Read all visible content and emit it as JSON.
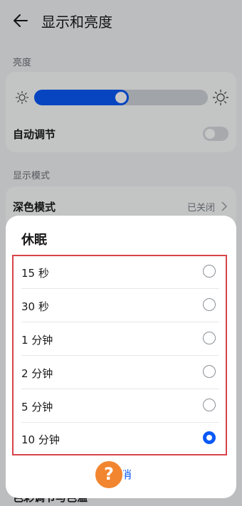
{
  "header": {
    "title": "显示和亮度"
  },
  "brightness": {
    "section_label": "亮度",
    "level_fraction": 0.5,
    "auto_label": "自动调节",
    "auto_on": false
  },
  "display_mode": {
    "section_label": "显示模式",
    "dark_mode_label": "深色模式",
    "dark_mode_value": "已关闭"
  },
  "behind_text": "色彩调节与色温",
  "sleep_dialog": {
    "title": "休眠",
    "options": [
      {
        "label": "15 秒",
        "selected": false
      },
      {
        "label": "30 秒",
        "selected": false
      },
      {
        "label": "1 分钟",
        "selected": false
      },
      {
        "label": "2 分钟",
        "selected": false
      },
      {
        "label": "5 分钟",
        "selected": false
      },
      {
        "label": "10 分钟",
        "selected": true
      }
    ],
    "cancel_label": "取消"
  },
  "colors": {
    "accent": "#0a59f7",
    "highlight": "#d9434a",
    "help_badge": "#f2852f"
  }
}
